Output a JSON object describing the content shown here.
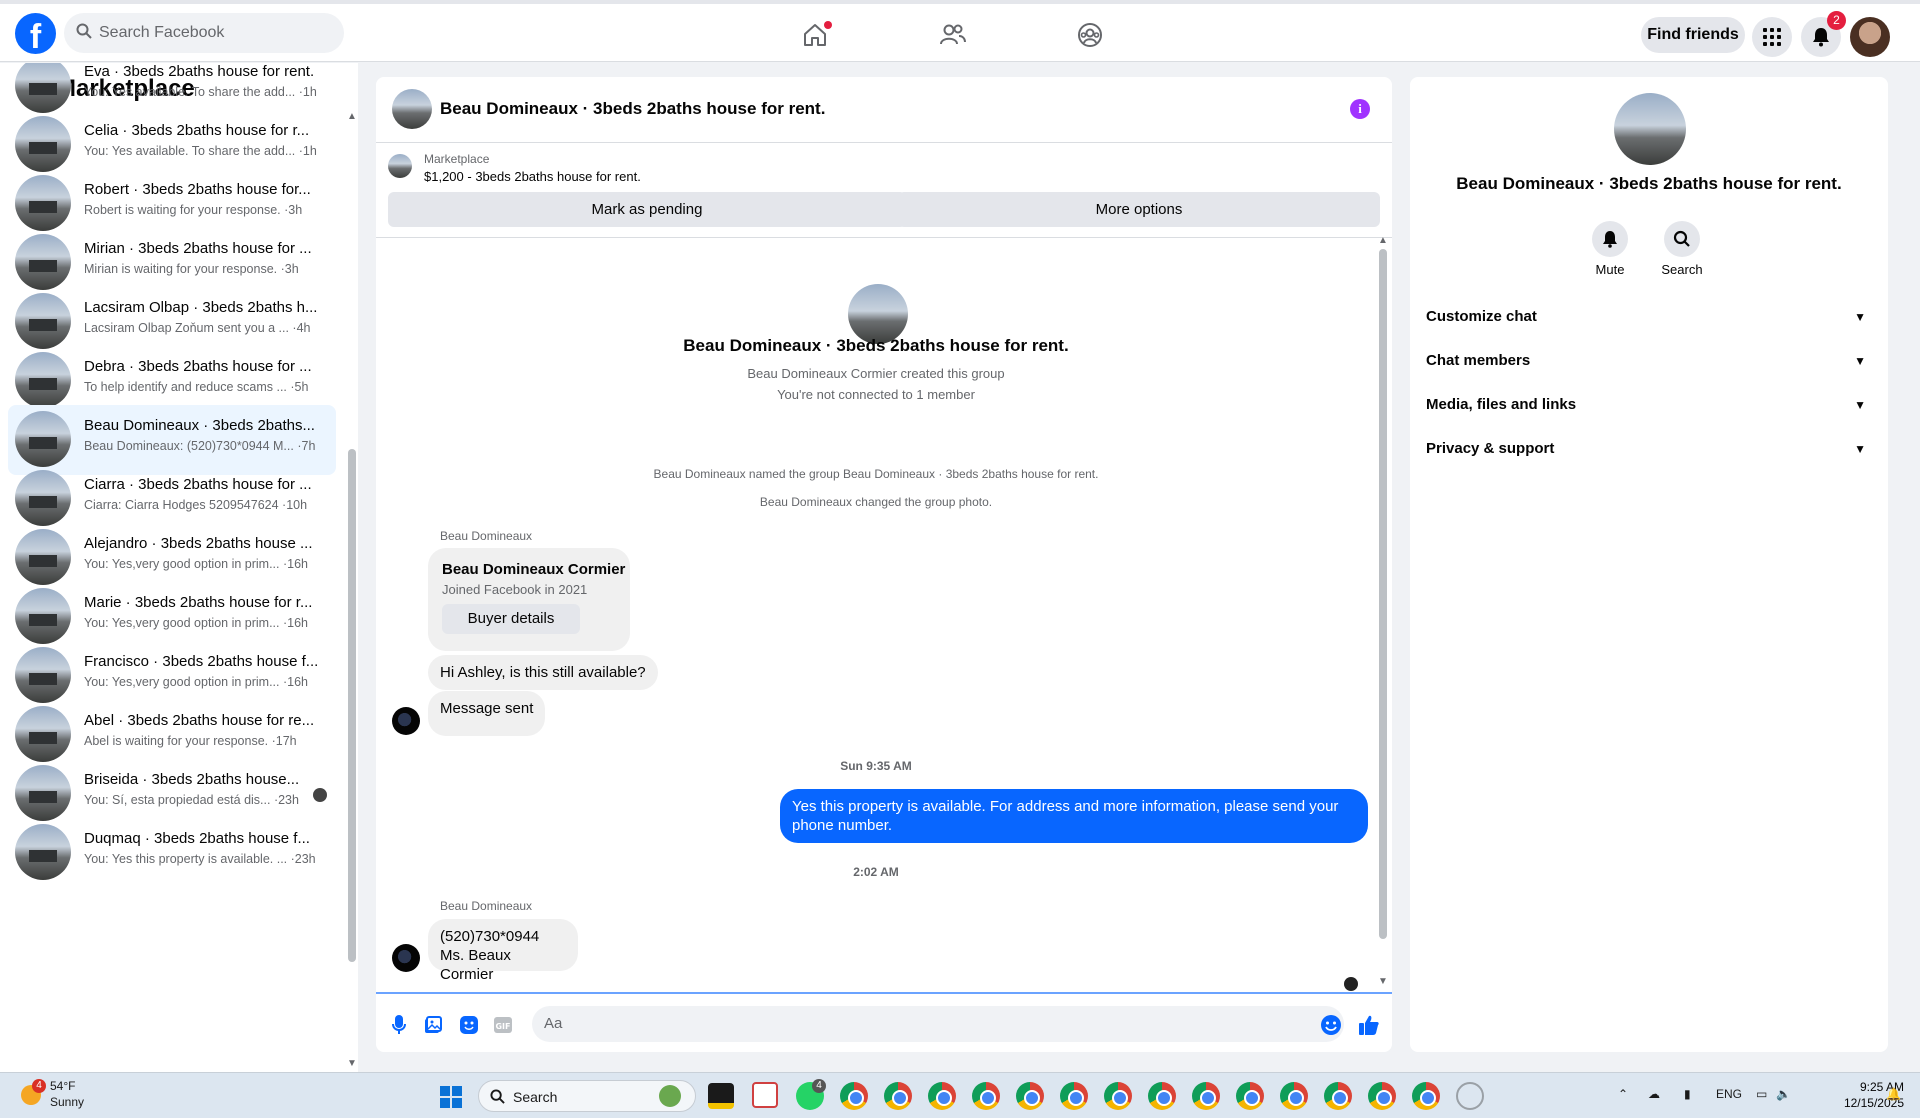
{
  "topbar": {
    "search_placeholder": "Search Facebook",
    "find_friends": "Find friends",
    "notif_count": "2"
  },
  "left": {
    "title": "Marketplace",
    "conversations": [
      {
        "title": "Eva · 3beds 2baths house for rent.",
        "snippet": "You: Yes available. To share the add... ·1h"
      },
      {
        "title": "Celia · 3beds 2baths house for r...",
        "snippet": "You: Yes available. To share the add... ·1h"
      },
      {
        "title": "Robert · 3beds 2baths house for...",
        "snippet": "Robert is waiting for your response. ·3h"
      },
      {
        "title": "Mirian · 3beds 2baths house for ...",
        "snippet": "Mirian is waiting for your response. ·3h"
      },
      {
        "title": "Lacsiram Olbap · 3beds 2baths h...",
        "snippet": "Lacsiram Olbap Zoňum sent you a ... ·4h"
      },
      {
        "title": "Debra · 3beds 2baths house for ...",
        "snippet": "To help identify and reduce scams ... ·5h"
      },
      {
        "title": "Beau Domineaux · 3beds 2baths...",
        "snippet": "Beau Domineaux: (520)730*0944 M... ·7h"
      },
      {
        "title": "Ciarra · 3beds 2baths house for ...",
        "snippet": "Ciarra: Ciarra Hodges 5209547624 ·10h"
      },
      {
        "title": "Alejandro · 3beds 2baths house ...",
        "snippet": "You: Yes,very good option in prim... ·16h"
      },
      {
        "title": "Marie · 3beds 2baths house for r...",
        "snippet": "You: Yes,very good option in prim... ·16h"
      },
      {
        "title": "Francisco · 3beds 2baths house f...",
        "snippet": "You: Yes,very good option in prim... ·16h"
      },
      {
        "title": "Abel · 3beds 2baths house for re...",
        "snippet": "Abel is waiting for your response. ·17h"
      },
      {
        "title": "Briseida · 3beds 2baths house...",
        "snippet": "You: Sí, esta propiedad está dis... ·23h"
      },
      {
        "title": "Duqmaq · 3beds 2baths house f...",
        "snippet": "You: Yes this property is available. ... ·23h"
      }
    ]
  },
  "chat": {
    "title": "Beau Domineaux · 3beds 2baths house for rent.",
    "marketplace_label": "Marketplace",
    "listing": "$1,200 - 3beds 2baths house for rent.",
    "mark_pending": "Mark as pending",
    "more_options": "More options",
    "group_name": "Beau Domineaux · 3beds 2baths house for rent.",
    "created_by": "Beau Domineaux Cormier created this group",
    "not_connected": "You're not connected to 1 member",
    "sys1": "Beau Domineaux named the group Beau Domineaux · 3beds 2baths house for rent.",
    "sys2": "Beau Domineaux changed the group photo.",
    "sender1": "Beau Domineaux",
    "card_name": "Beau Domineaux Cormier",
    "card_joined": "Joined Facebook in 2021",
    "buyer_details": "Buyer details",
    "msg1": "Hi Ashley, is this still available?",
    "msg2": "Message sent",
    "time1": "Sun 9:35 AM",
    "out_msg": "Yes this property is available. For address and more information, please send your phone number.",
    "time2": "2:02 AM",
    "sender2": "Beau Domineaux",
    "last_msg_line1": "(520)730*0944",
    "last_msg_line2": "Ms. Beaux Cormier",
    "composer_placeholder": "Aa"
  },
  "right": {
    "title": "Beau Domineaux · 3beds 2baths house for rent.",
    "mute": "Mute",
    "search": "Search",
    "sections": [
      "Customize chat",
      "Chat members",
      "Media, files and links",
      "Privacy & support"
    ]
  },
  "taskbar": {
    "temp": "54°F",
    "condition": "Sunny",
    "weather_badge": "4",
    "search": "Search",
    "whatsapp_badge": "4",
    "lang": "ENG",
    "time": "9:25 AM",
    "date": "12/15/2025"
  },
  "colors": {
    "brand": "#0866ff",
    "info": "#a033ff",
    "badge": "#e41e3f"
  }
}
